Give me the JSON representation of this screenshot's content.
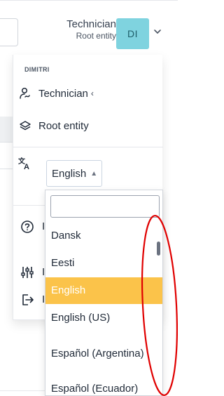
{
  "header": {
    "title": "Technician",
    "subtitle": "Root entity",
    "avatar_initials": "DI",
    "avatar_color": "#7fd3df"
  },
  "user_menu": {
    "section_title": "DIMITRI",
    "profile_label": "Technician",
    "profile_icon": "user-switch-icon",
    "entity_label": "Root entity",
    "entity_icon": "layers-icon",
    "language_icon": "translate-icon",
    "language_value": "English",
    "help_icon": "help-circle-icon",
    "settings_icon": "sliders-icon",
    "logout_icon": "logout-icon",
    "partial_label_help": "I",
    "partial_label_settings": "I",
    "partial_label_logout": "I"
  },
  "language_dropdown": {
    "search_value": "",
    "options": [
      "Dansk",
      "Eesti",
      "English",
      "English (US)",
      "Español (Argentina)",
      "Español (Ecuador)"
    ],
    "selected_option": "English",
    "selected_color": "#fbc34a"
  },
  "annotation": {
    "color": "#e00000"
  }
}
